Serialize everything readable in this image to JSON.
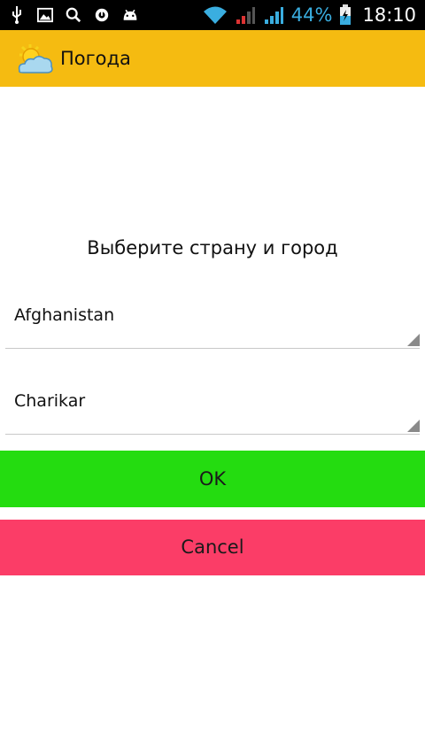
{
  "status_bar": {
    "icons_left": [
      "usb-icon",
      "image-icon",
      "search-icon",
      "sync-icon",
      "android-icon"
    ],
    "icons_right": [
      "wifi-icon",
      "signal-icon-1",
      "signal-icon-2",
      "battery-icon"
    ],
    "battery": "44%",
    "time": "18:10"
  },
  "action_bar": {
    "title": "Погода",
    "icon": "weather-sun-cloud-icon"
  },
  "main": {
    "prompt": "Выберите страну и город",
    "country_spinner": {
      "value": "Afghanistan"
    },
    "city_spinner": {
      "value": "Charikar"
    },
    "ok_label": "OK",
    "cancel_label": "Cancel"
  },
  "colors": {
    "action_bar": "#f5bb11",
    "ok_button": "#24dc10",
    "cancel_button": "#fb3d67",
    "status_accent": "#3aaee0"
  }
}
